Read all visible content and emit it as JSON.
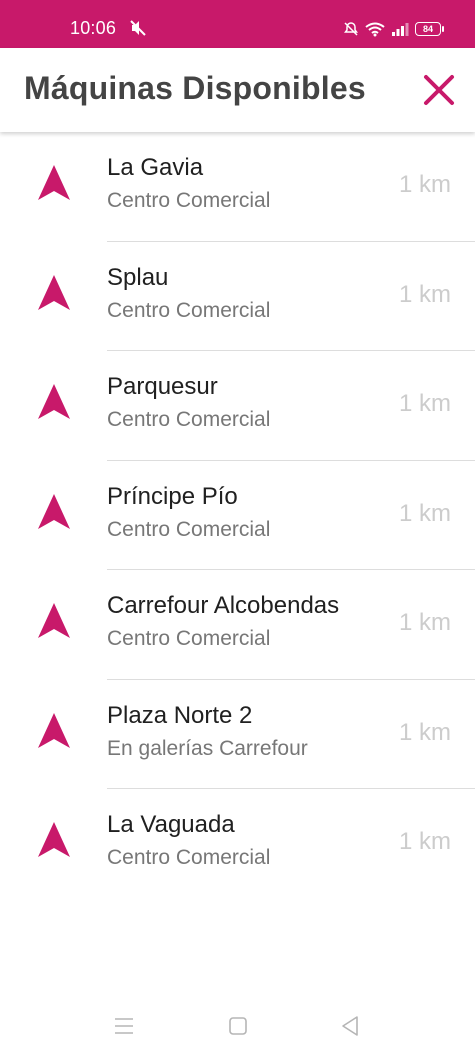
{
  "status_bar": {
    "time": "10:06",
    "battery": "84",
    "icons": [
      "mute-icon",
      "alarm-off-icon",
      "wifi-icon",
      "signal-icon",
      "battery-icon"
    ]
  },
  "header": {
    "title": "Máquinas Disponibles",
    "close_icon": "close-icon"
  },
  "colors": {
    "accent": "#c8196a",
    "title_text": "#444444",
    "item_text": "#202020",
    "subtitle_text": "#777777",
    "distance_text": "#cccccc",
    "divider": "#dddddd"
  },
  "locations": [
    {
      "name": "La Gavia",
      "subtitle": "Centro Comercial",
      "distance": "1 km"
    },
    {
      "name": "Splau",
      "subtitle": "Centro Comercial",
      "distance": "1 km"
    },
    {
      "name": "Parquesur",
      "subtitle": "Centro Comercial",
      "distance": "1 km"
    },
    {
      "name": "Príncipe Pío",
      "subtitle": "Centro Comercial",
      "distance": "1 km"
    },
    {
      "name": "Carrefour Alcobendas",
      "subtitle": "Centro Comercial",
      "distance": "1 km"
    },
    {
      "name": "Plaza Norte 2",
      "subtitle": "En galerías Carrefour",
      "distance": "1 km"
    },
    {
      "name": "La Vaguada",
      "subtitle": "Centro Comercial",
      "distance": "1 km"
    }
  ],
  "nav_bar": {
    "buttons": [
      "menu-icon",
      "home-icon",
      "back-icon"
    ]
  }
}
